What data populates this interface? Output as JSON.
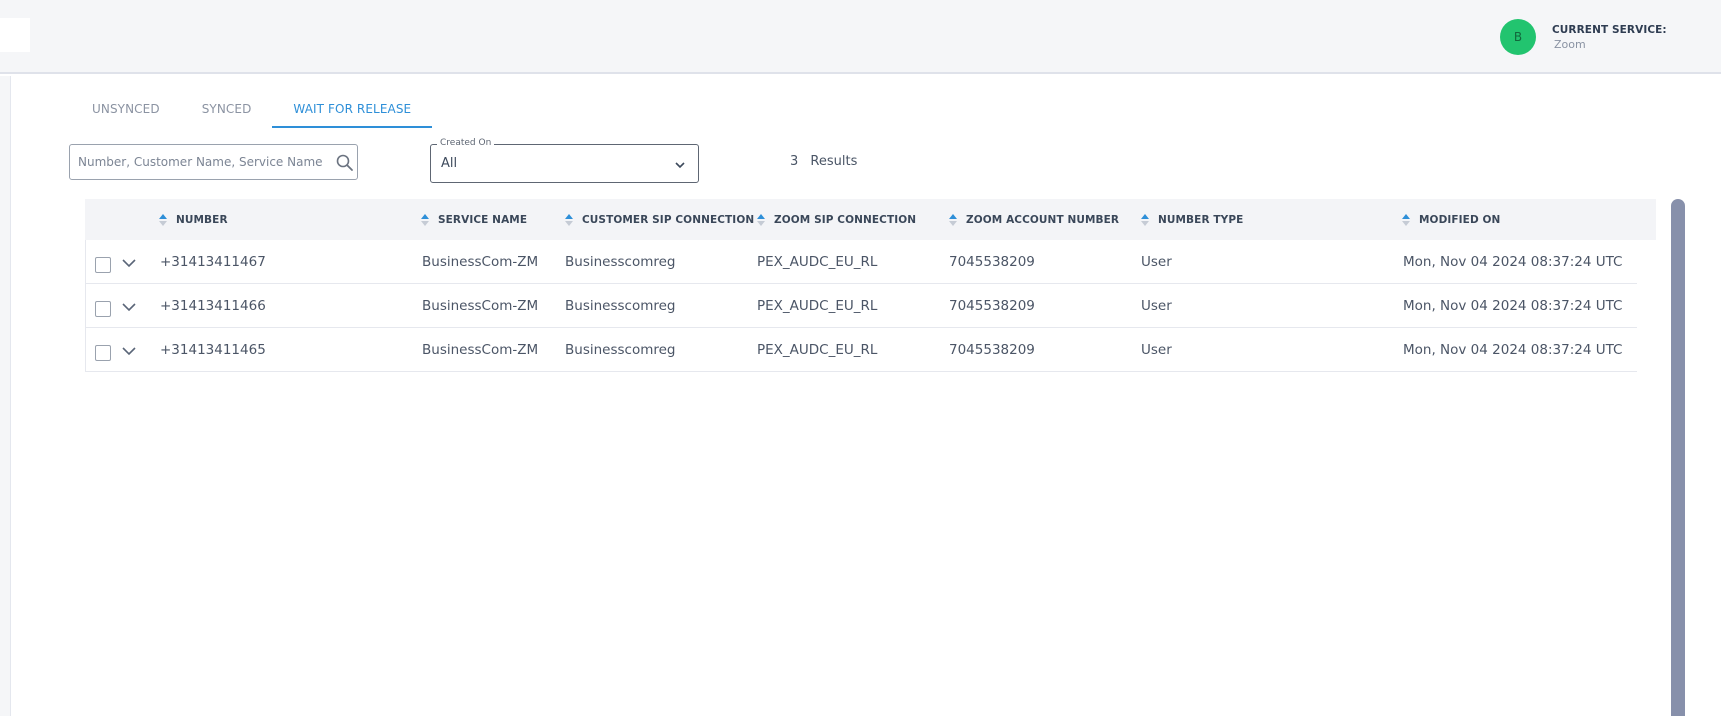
{
  "header": {
    "avatar_initial": "B",
    "service_label": "CURRENT SERVICE:",
    "service_value": "Zoom"
  },
  "tabs": [
    {
      "label": "UNSYNCED",
      "active": false
    },
    {
      "label": "SYNCED",
      "active": false
    },
    {
      "label": "WAIT FOR RELEASE",
      "active": true
    }
  ],
  "filters": {
    "search_placeholder": "Number, Customer Name, Service Name",
    "created_on_label": "Created On",
    "created_on_value": "All",
    "results_count": "3",
    "results_label": "Results"
  },
  "table": {
    "columns": [
      "NUMBER",
      "SERVICE NAME",
      "CUSTOMER SIP CONNECTION",
      "ZOOM SIP CONNECTION",
      "ZOOM ACCOUNT NUMBER",
      "NUMBER TYPE",
      "MODIFIED ON"
    ],
    "rows": [
      [
        "+31413411467",
        "BusinessCom-ZM",
        "Businesscomreg",
        "PEX_AUDC_EU_RL",
        "7045538209",
        "User",
        "Mon, Nov 04 2024 08:37:24 UTC"
      ],
      [
        "+31413411466",
        "BusinessCom-ZM",
        "Businesscomreg",
        "PEX_AUDC_EU_RL",
        "7045538209",
        "User",
        "Mon, Nov 04 2024 08:37:24 UTC"
      ],
      [
        "+31413411465",
        "BusinessCom-ZM",
        "Businesscomreg",
        "PEX_AUDC_EU_RL",
        "7045538209",
        "User",
        "Mon, Nov 04 2024 08:37:24 UTC"
      ]
    ]
  },
  "colors": {
    "accent": "#2e8fd8",
    "avatar": "#22c46f",
    "scrollbar": "#8790ab"
  },
  "icons": {
    "search": "search-icon",
    "dropdown": "chevron-down-icon",
    "sort": "sort-icon",
    "expand": "chevron-down-icon"
  }
}
